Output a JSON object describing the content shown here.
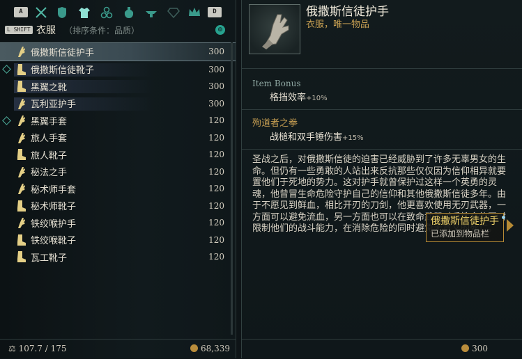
{
  "tabs": {
    "key_left": "A",
    "key_right": "D",
    "icons": [
      "weapons-icon",
      "armor-icon",
      "clothing-icon",
      "accessories-icon",
      "consumables-icon",
      "misc-icon",
      "gems-icon",
      "crown-icon"
    ]
  },
  "category": {
    "shift_key": "L SHIFT",
    "title": "衣服",
    "sort_label": "（排序条件：品质）"
  },
  "items": [
    {
      "name": "俄撒斯信徒护手",
      "price": "300",
      "icon": "glove-icon",
      "selected": true,
      "marked": false,
      "highlight": false
    },
    {
      "name": "俄撒斯信徒靴子",
      "price": "300",
      "icon": "boot-icon",
      "selected": false,
      "marked": true,
      "highlight": true
    },
    {
      "name": "黑翼之靴",
      "price": "300",
      "icon": "boot-icon",
      "selected": false,
      "marked": false,
      "highlight": true
    },
    {
      "name": "瓦利亚护手",
      "price": "300",
      "icon": "glove-icon",
      "selected": false,
      "marked": false,
      "highlight": true
    },
    {
      "name": "黑翼手套",
      "price": "120",
      "icon": "glove-icon",
      "selected": false,
      "marked": true,
      "highlight": false
    },
    {
      "name": "旅人手套",
      "price": "120",
      "icon": "glove-icon",
      "selected": false,
      "marked": false,
      "highlight": false
    },
    {
      "name": "旅人靴子",
      "price": "120",
      "icon": "boot-icon",
      "selected": false,
      "marked": false,
      "highlight": false
    },
    {
      "name": "秘法之手",
      "price": "120",
      "icon": "glove-icon",
      "selected": false,
      "marked": false,
      "highlight": false
    },
    {
      "name": "秘术师手套",
      "price": "120",
      "icon": "glove-icon",
      "selected": false,
      "marked": false,
      "highlight": false
    },
    {
      "name": "秘术师靴子",
      "price": "120",
      "icon": "boot-icon",
      "selected": false,
      "marked": false,
      "highlight": false
    },
    {
      "name": "铁绞喉护手",
      "price": "120",
      "icon": "glove-icon",
      "selected": false,
      "marked": false,
      "highlight": false
    },
    {
      "name": "铁绞喉靴子",
      "price": "120",
      "icon": "boot-icon",
      "selected": false,
      "marked": false,
      "highlight": false
    },
    {
      "name": "瓦工靴子",
      "price": "120",
      "icon": "boot-icon",
      "selected": false,
      "marked": false,
      "highlight": false
    }
  ],
  "footer": {
    "weight": "107.7 / 175",
    "gold": "68,339"
  },
  "detail": {
    "title": "俄撒斯信徒护手",
    "subtitle": "衣服，唯一物品",
    "bonus_header": "Item Bonus",
    "bonus_text": "格挡效率",
    "bonus_value": "+10%",
    "set_header": "殉道者之拳",
    "set_text": "战槌和双手锤伤害",
    "set_value": "+15%",
    "description": "圣战之后，对俄撒斯信徒的迫害已经威胁到了许多无辜男女的生命。但仍有一些勇敢的人站出来反抗那些仅仅因为信仰相异就要置他们于死地的势力。这对护手就曾保护过这样一个英勇的灵魂，他曾冒生命危险守护自己的信仰和其他俄撒斯信徒多年。由于不愿见到鲜血，相比开刃的刀剑，他更喜欢使用无刃武器，一方面可以避免流血，另一方面也可以在致命武器对手性命的同时限制他们的战斗能力，在消除危险的同时避免无意义的死亡。",
    "price": "300"
  },
  "tooltip": {
    "title": "俄撒斯信徒护手",
    "text": "已添加到物品栏"
  },
  "colors": {
    "accent": "#27a28f",
    "gold_text": "#c79f52",
    "tooltip_border": "#b58a35"
  }
}
